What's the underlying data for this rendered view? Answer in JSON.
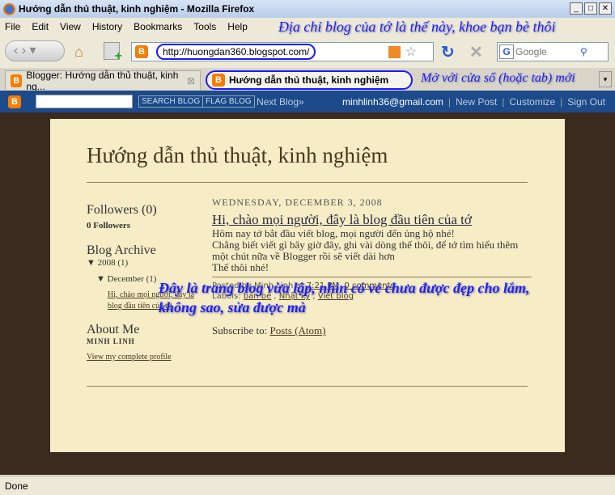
{
  "window": {
    "title": "Hướng dẫn thủ thuật, kinh nghiệm - Mozilla Firefox"
  },
  "menu": [
    "File",
    "Edit",
    "View",
    "History",
    "Bookmarks",
    "Tools",
    "Help"
  ],
  "annotations": {
    "url_note": "Địa chỉ blog của tớ là thế này, khoe bạn bè thôi",
    "tab_note": "Mở với cửa sổ (hoặc tab) mới",
    "page_note": "Đây là trang blog vừa lập, nhìn có vẻ chưa được đẹp cho lắm, không sao, sửa được mà"
  },
  "address": {
    "url": "http://huongdan360.blogspot.com/"
  },
  "search": {
    "placeholder": "Google"
  },
  "tabs": [
    {
      "label": "Blogger: Hướng dẫn thủ thuật, kinh ng..."
    },
    {
      "label": "Hướng dẫn thủ thuật, kinh nghiệm"
    }
  ],
  "blogbar": {
    "search_btn": "SEARCH BLOG",
    "flag_btn": "FLAG BLOG",
    "next": "Next Blog»",
    "email": "minhlinh36@gmail.com",
    "new_post": "New Post",
    "customize": "Customize",
    "sign_out": "Sign Out"
  },
  "blog": {
    "title": "Hướng dẫn thủ thuật, kinh nghiệm",
    "followers_h": "Followers (0)",
    "followers": "0 Followers",
    "archive_h": "Blog Archive",
    "year": "▼ 2008 (1)",
    "month": "▼ December (1)",
    "archive_post": "Hi, chào mọi người, đây là blog đầu tiên của tớ",
    "about_h": "About Me",
    "author": "MINH LINH",
    "profile": "View my complete profile",
    "date": "Wednesday, December 3, 2008",
    "post_title": "Hi, chào mọi người, đây là blog đầu tiên của tớ",
    "post_lines": [
      "Hôm nay tớ bắt đầu viết blog, mọi người đến ủng hộ nhé!",
      "Chẳng biết viết gì bây giờ đây, ghi vài dòng thế thôi, để tớ tìm hiểu thêm một chút nữa về Blogger rồi sẽ viết dài hơn",
      "Thế thôi nhé!"
    ],
    "posted_by": "Posted by Minh Linh at",
    "time": "7:21 PM",
    "comments": "0 comments",
    "labels_h": "Labels:",
    "labels": [
      "ban bè",
      "Nhật ký",
      "Viết blog"
    ],
    "subscribe": "Subscribe to:",
    "subscribe_link": "Posts (Atom)"
  },
  "status": "Done"
}
